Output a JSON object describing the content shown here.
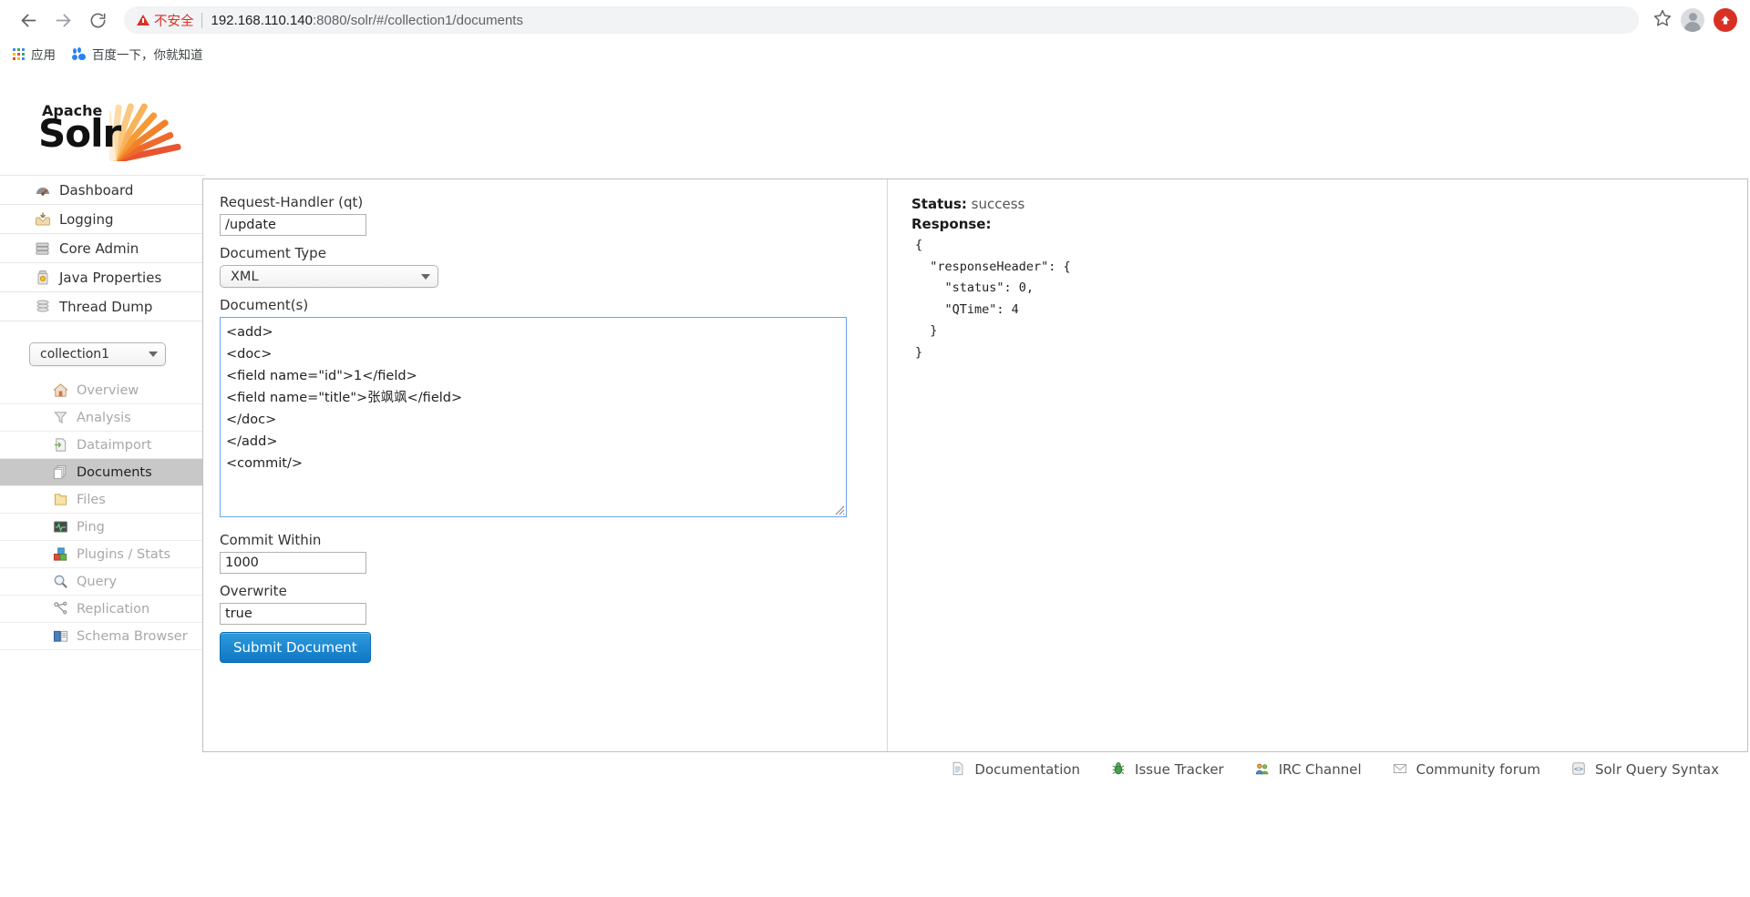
{
  "browser": {
    "back_icon": "back-arrow-icon",
    "forward_icon": "forward-arrow-icon",
    "reload_icon": "reload-icon",
    "security_label": "不安全",
    "url_host": "192.168.110.140",
    "url_rest": ":8080/solr/#/collection1/documents",
    "url_full": "192.168.110.140:8080/solr/#/collection1/documents",
    "bookmarks": [
      {
        "label": "应用",
        "icon": "apps-grid-icon"
      },
      {
        "label": "百度一下，你就知道",
        "icon": "baidu-icon"
      }
    ]
  },
  "logo": {
    "apache": "Apache",
    "solr": "Solr"
  },
  "menu": {
    "items": [
      {
        "label": "Dashboard",
        "icon": "dashboard-icon"
      },
      {
        "label": "Logging",
        "icon": "logging-icon"
      },
      {
        "label": "Core Admin",
        "icon": "core-admin-icon"
      },
      {
        "label": "Java Properties",
        "icon": "java-properties-icon"
      },
      {
        "label": "Thread Dump",
        "icon": "thread-dump-icon"
      }
    ]
  },
  "collection": {
    "selected": "collection1",
    "items": [
      {
        "label": "Overview",
        "icon": "home-icon",
        "active": false
      },
      {
        "label": "Analysis",
        "icon": "funnel-icon",
        "active": false
      },
      {
        "label": "Dataimport",
        "icon": "dataimport-icon",
        "active": false
      },
      {
        "label": "Documents",
        "icon": "documents-icon",
        "active": true
      },
      {
        "label": "Files",
        "icon": "folder-icon",
        "active": false
      },
      {
        "label": "Ping",
        "icon": "ping-icon",
        "active": false
      },
      {
        "label": "Plugins / Stats",
        "icon": "plugins-icon",
        "active": false
      },
      {
        "label": "Query",
        "icon": "magnifier-icon",
        "active": false
      },
      {
        "label": "Replication",
        "icon": "replication-icon",
        "active": false
      },
      {
        "label": "Schema Browser",
        "icon": "book-icon",
        "active": false
      }
    ]
  },
  "form": {
    "request_handler_label": "Request-Handler (qt)",
    "request_handler_value": "/update",
    "document_type_label": "Document Type",
    "document_type_value": "XML",
    "documents_label": "Document(s)",
    "documents_value": "<add>\n<doc>\n<field name=\"id\">1</field>\n<field name=\"title\">张飒飒</field>\n</doc>\n</add>\n<commit/>",
    "commit_within_label": "Commit Within",
    "commit_within_value": "1000",
    "overwrite_label": "Overwrite",
    "overwrite_value": "true",
    "submit_label": "Submit Document"
  },
  "response": {
    "status_label": "Status:",
    "status_value": "success",
    "response_label": "Response:",
    "json": "{\n  \"responseHeader\": {\n    \"status\": 0,\n    \"QTime\": 4\n  }\n}"
  },
  "footer": {
    "links": [
      {
        "label": "Documentation",
        "icon": "document-page-icon"
      },
      {
        "label": "Issue Tracker",
        "icon": "bug-icon"
      },
      {
        "label": "IRC Channel",
        "icon": "people-icon"
      },
      {
        "label": "Community forum",
        "icon": "envelope-icon"
      },
      {
        "label": "Solr Query Syntax",
        "icon": "code-icon"
      }
    ]
  },
  "colors": {
    "accent_blue": "#1077c4",
    "insecure_red": "#d93025",
    "active_bg": "#c8c8c8",
    "solr_orange": "#e8542f"
  }
}
